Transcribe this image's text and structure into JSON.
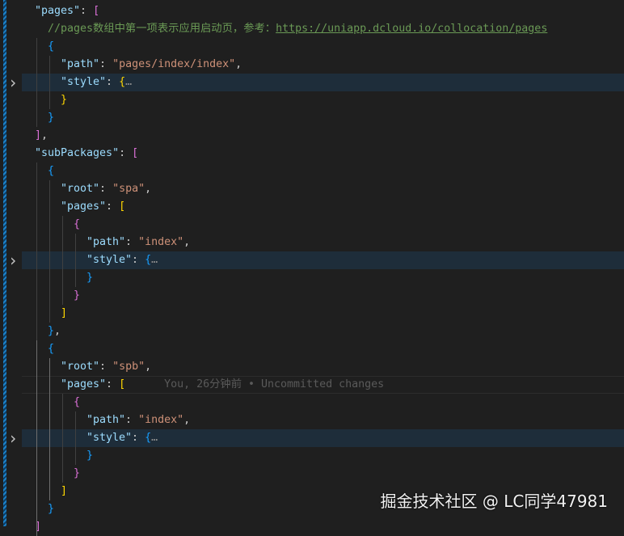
{
  "editor": {
    "fold_icon": "chevron-right-icon",
    "colors": {
      "key": "#9cdcfe",
      "string": "#ce9178",
      "comment": "#6a9955",
      "bracket_purple": "#da70d6",
      "bracket_blue": "#179fff",
      "bracket_gold": "#ffd700"
    },
    "lines": [
      {
        "indent": 1,
        "tokens": [
          {
            "t": "\"pages\"",
            "c": "key"
          },
          {
            "t": ": ",
            "c": "punc"
          },
          {
            "t": "[",
            "c": "b-purple"
          }
        ]
      },
      {
        "indent": 2,
        "tokens": [
          {
            "t": "//pages数组中第一项表示应用启动页，参考：",
            "c": "comment"
          },
          {
            "t": "https://uniapp.dcloud.io/collocation/pages",
            "c": "link"
          }
        ]
      },
      {
        "indent": 2,
        "tokens": [
          {
            "t": "{",
            "c": "b-blue"
          }
        ]
      },
      {
        "indent": 3,
        "tokens": [
          {
            "t": "\"path\"",
            "c": "key"
          },
          {
            "t": ": ",
            "c": "punc"
          },
          {
            "t": "\"pages/index/index\"",
            "c": "str"
          },
          {
            "t": ",",
            "c": "punc"
          }
        ]
      },
      {
        "indent": 3,
        "folded": true,
        "tokens": [
          {
            "t": "\"style\"",
            "c": "key"
          },
          {
            "t": ": ",
            "c": "punc"
          },
          {
            "t": "{",
            "c": "b-gold"
          },
          {
            "t": "…",
            "c": "ellipsis"
          }
        ]
      },
      {
        "indent": 3,
        "tokens": [
          {
            "t": "}",
            "c": "b-gold"
          }
        ]
      },
      {
        "indent": 2,
        "tokens": [
          {
            "t": "}",
            "c": "b-blue"
          }
        ]
      },
      {
        "indent": 1,
        "tokens": [
          {
            "t": "]",
            "c": "b-purple"
          },
          {
            "t": ",",
            "c": "punc"
          }
        ]
      },
      {
        "indent": 1,
        "tokens": [
          {
            "t": "\"subPackages\"",
            "c": "key"
          },
          {
            "t": ": ",
            "c": "punc"
          },
          {
            "t": "[",
            "c": "b-purple"
          }
        ]
      },
      {
        "indent": 2,
        "tokens": [
          {
            "t": "{",
            "c": "b-blue"
          }
        ]
      },
      {
        "indent": 3,
        "tokens": [
          {
            "t": "\"root\"",
            "c": "key"
          },
          {
            "t": ": ",
            "c": "punc"
          },
          {
            "t": "\"spa\"",
            "c": "str"
          },
          {
            "t": ",",
            "c": "punc"
          }
        ]
      },
      {
        "indent": 3,
        "tokens": [
          {
            "t": "\"pages\"",
            "c": "key"
          },
          {
            "t": ": ",
            "c": "punc"
          },
          {
            "t": "[",
            "c": "b-gold"
          }
        ]
      },
      {
        "indent": 4,
        "tokens": [
          {
            "t": "{",
            "c": "b-purple"
          }
        ]
      },
      {
        "indent": 5,
        "tokens": [
          {
            "t": "\"path\"",
            "c": "key"
          },
          {
            "t": ": ",
            "c": "punc"
          },
          {
            "t": "\"index\"",
            "c": "str"
          },
          {
            "t": ",",
            "c": "punc"
          }
        ]
      },
      {
        "indent": 5,
        "folded": true,
        "tokens": [
          {
            "t": "\"style\"",
            "c": "key"
          },
          {
            "t": ": ",
            "c": "punc"
          },
          {
            "t": "{",
            "c": "b-blue"
          },
          {
            "t": "…",
            "c": "ellipsis"
          }
        ]
      },
      {
        "indent": 5,
        "tokens": [
          {
            "t": "}",
            "c": "b-blue"
          }
        ]
      },
      {
        "indent": 4,
        "tokens": [
          {
            "t": "}",
            "c": "b-purple"
          }
        ]
      },
      {
        "indent": 3,
        "tokens": [
          {
            "t": "]",
            "c": "b-gold"
          }
        ]
      },
      {
        "indent": 2,
        "tokens": [
          {
            "t": "}",
            "c": "b-blue"
          },
          {
            "t": ",",
            "c": "punc"
          }
        ]
      },
      {
        "indent": 2,
        "tokens": [
          {
            "t": "{",
            "c": "b-blue"
          }
        ]
      },
      {
        "indent": 3,
        "tokens": [
          {
            "t": "\"root\"",
            "c": "key"
          },
          {
            "t": ": ",
            "c": "punc"
          },
          {
            "t": "\"spb\"",
            "c": "str"
          },
          {
            "t": ",",
            "c": "punc"
          }
        ]
      },
      {
        "indent": 3,
        "current": true,
        "tokens": [
          {
            "t": "\"pages\"",
            "c": "key"
          },
          {
            "t": ": ",
            "c": "punc"
          },
          {
            "t": "[",
            "c": "b-gold"
          },
          {
            "t": "You, 26分钟前 • Uncommitted changes",
            "c": "blame"
          }
        ]
      },
      {
        "indent": 4,
        "tokens": [
          {
            "t": "{",
            "c": "b-purple"
          }
        ]
      },
      {
        "indent": 5,
        "tokens": [
          {
            "t": "\"path\"",
            "c": "key"
          },
          {
            "t": ": ",
            "c": "punc"
          },
          {
            "t": "\"index\"",
            "c": "str"
          },
          {
            "t": ",",
            "c": "punc"
          }
        ]
      },
      {
        "indent": 5,
        "folded": true,
        "tokens": [
          {
            "t": "\"style\"",
            "c": "key"
          },
          {
            "t": ": ",
            "c": "punc"
          },
          {
            "t": "{",
            "c": "b-blue"
          },
          {
            "t": "…",
            "c": "ellipsis"
          }
        ]
      },
      {
        "indent": 5,
        "tokens": [
          {
            "t": "}",
            "c": "b-blue"
          }
        ]
      },
      {
        "indent": 4,
        "tokens": [
          {
            "t": "}",
            "c": "b-purple"
          }
        ]
      },
      {
        "indent": 3,
        "tokens": [
          {
            "t": "]",
            "c": "b-gold"
          }
        ]
      },
      {
        "indent": 2,
        "tokens": [
          {
            "t": "}",
            "c": "b-blue"
          }
        ]
      },
      {
        "indent": 1,
        "tokens": [
          {
            "t": "]",
            "c": "b-purple"
          }
        ]
      }
    ]
  },
  "watermark": "掘金技术社区 @ LC同学47981"
}
